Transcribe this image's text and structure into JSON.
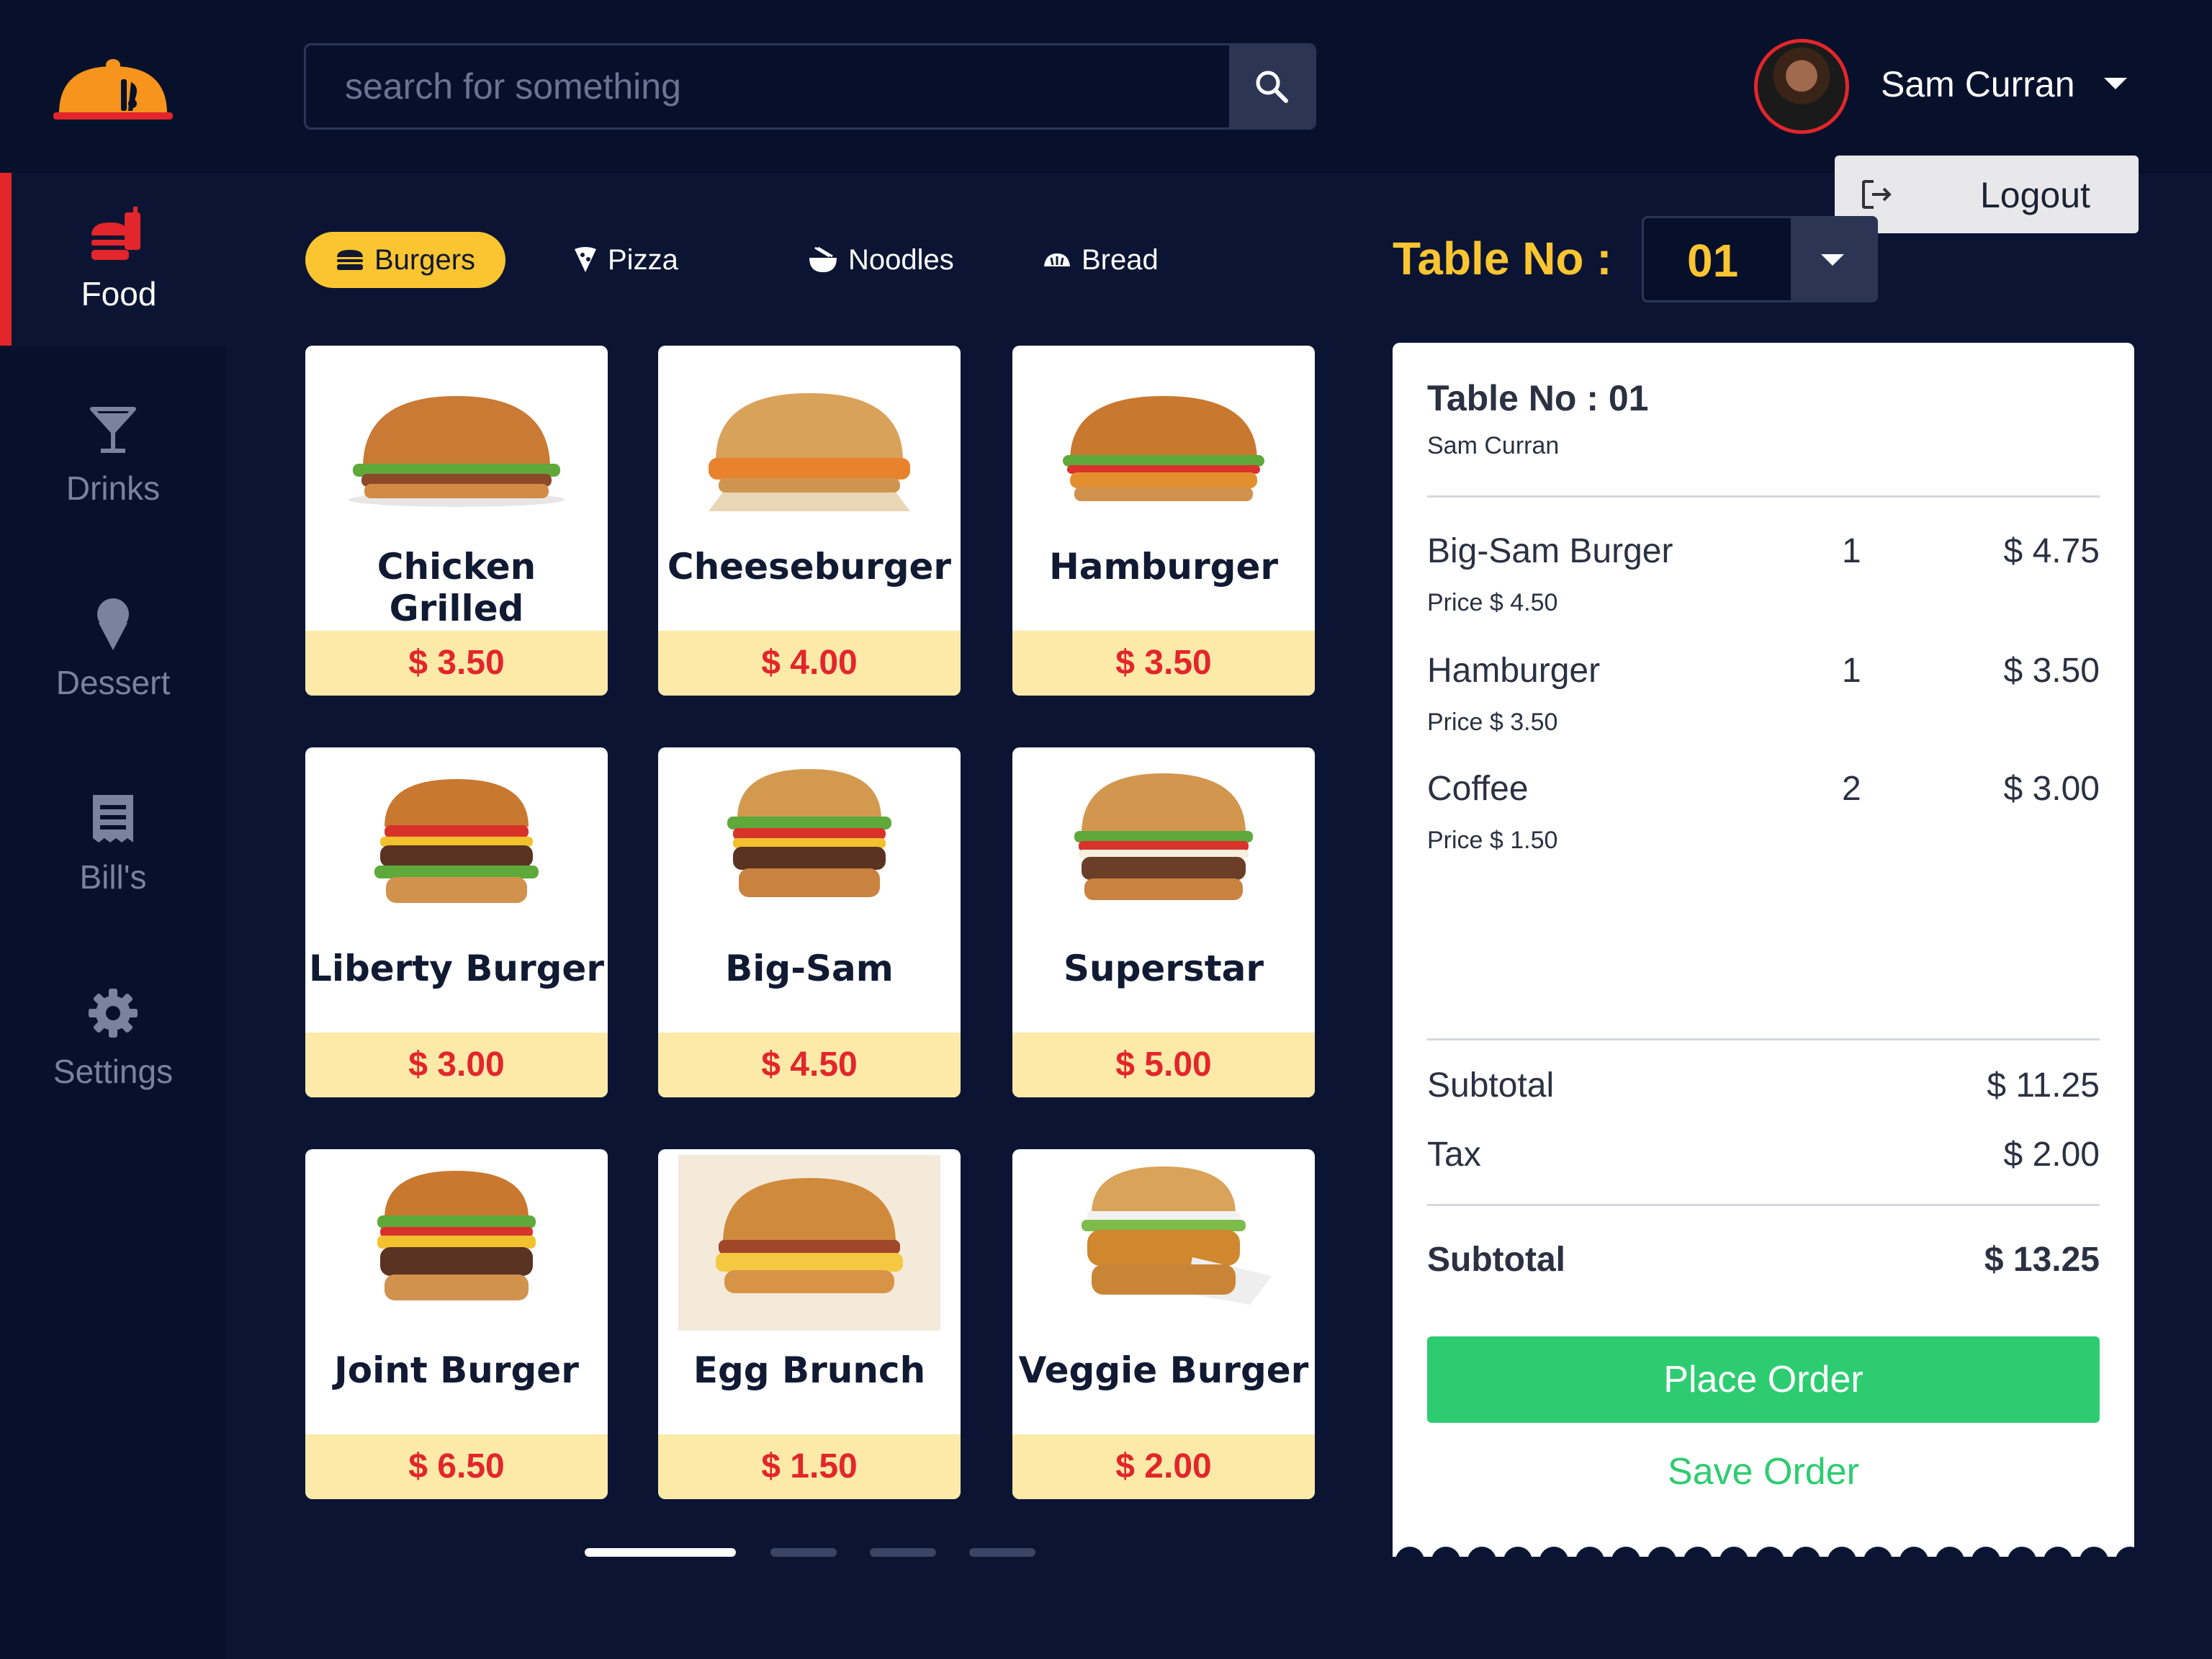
{
  "header": {
    "search_placeholder": "search for something",
    "user_name": "Sam Curran",
    "logout_label": "Logout"
  },
  "sidebar": {
    "items": [
      {
        "label": "Food",
        "icon": "food-icon",
        "active": true
      },
      {
        "label": "Drinks",
        "icon": "cocktail-icon",
        "active": false
      },
      {
        "label": "Dessert",
        "icon": "ice-cream-icon",
        "active": false
      },
      {
        "label": "Bill's",
        "icon": "receipt-icon",
        "active": false
      },
      {
        "label": "Settings",
        "icon": "gear-icon",
        "active": false
      }
    ]
  },
  "categories": [
    {
      "label": "Burgers",
      "icon": "burger-icon",
      "active": true
    },
    {
      "label": "Pizza",
      "icon": "pizza-icon",
      "active": false
    },
    {
      "label": "Noodles",
      "icon": "noodles-icon",
      "active": false
    },
    {
      "label": "Bread",
      "icon": "bread-icon",
      "active": false
    }
  ],
  "table": {
    "label": "Table No :",
    "value": "01"
  },
  "menu": [
    {
      "name": "Chicken Grilled",
      "price": "$ 3.50"
    },
    {
      "name": "Cheeseburger",
      "price": "$ 4.00"
    },
    {
      "name": "Hamburger",
      "price": "$ 3.50"
    },
    {
      "name": "Liberty Burger",
      "price": "$ 3.00"
    },
    {
      "name": "Big-Sam",
      "price": "$ 4.50"
    },
    {
      "name": "Superstar",
      "price": "$ 5.00"
    },
    {
      "name": "Joint Burger",
      "price": "$ 6.50"
    },
    {
      "name": "Egg Brunch",
      "price": "$ 1.50"
    },
    {
      "name": "Veggie Burger",
      "price": "$ 2.00"
    }
  ],
  "pagination": {
    "pages": 4,
    "current": 1
  },
  "order": {
    "title": "Table No : 01",
    "customer": "Sam Curran",
    "items": [
      {
        "name": "Big-Sam Burger",
        "unit_price": "Price $ 4.50",
        "qty": "1",
        "total": "$ 4.75"
      },
      {
        "name": "Hamburger",
        "unit_price": "Price $ 3.50",
        "qty": "1",
        "total": "$ 3.50"
      },
      {
        "name": "Coffee",
        "unit_price": "Price $ 1.50",
        "qty": "2",
        "total": "$ 3.00"
      }
    ],
    "subtotal_label": "Subtotal",
    "subtotal_value": "$ 11.25",
    "tax_label": "Tax",
    "tax_value": "$ 2.00",
    "total_label": "Subtotal",
    "total_value": "$ 13.25",
    "place_order_label": "Place Order",
    "save_order_label": "Save Order"
  },
  "colors": {
    "background": "#0b1533",
    "accent": "#fbc531",
    "danger": "#e3262b",
    "success": "#2ecc71"
  }
}
